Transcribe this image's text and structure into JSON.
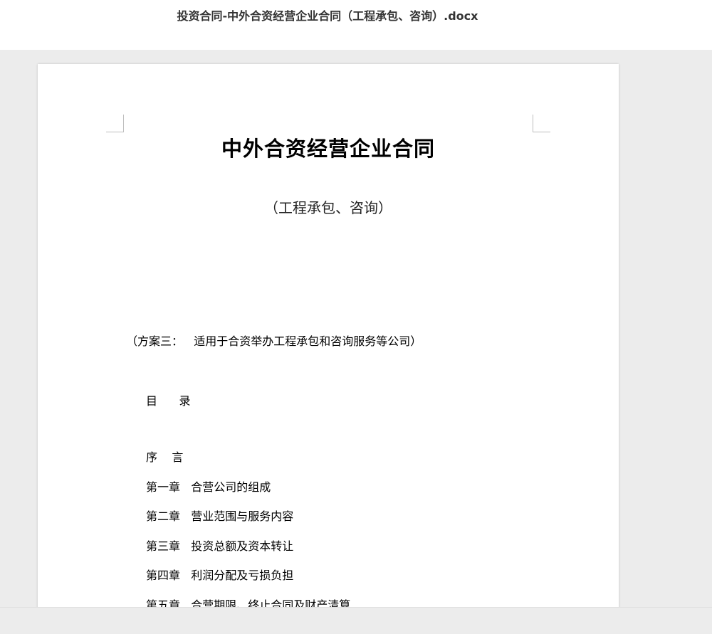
{
  "window": {
    "title": "投资合同-中外合资经营企业合同（工程承包、咨询）.docx"
  },
  "document": {
    "title": "中外合资经营企业合同",
    "subtitle": "（工程承包、咨询）",
    "scheme_note": "（方案三：   适用于合资举办工程承包和咨询服务等公司）",
    "toc_heading": "目      录",
    "toc_items": [
      "序    言",
      "第一章   合营公司的组成",
      "第二章   营业范围与服务内容",
      "第三章   投资总额及资本转让",
      "第四章   利润分配及亏损负担",
      "第五章   合营期限、终止合同及财产清算"
    ]
  }
}
